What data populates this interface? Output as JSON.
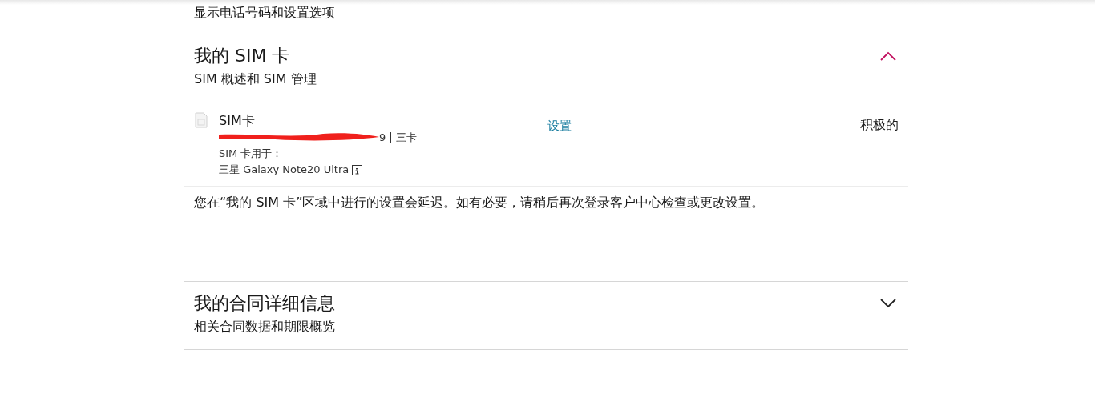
{
  "sections": [
    {
      "subtitle": "显示电话号码和设置选项"
    },
    {
      "title": "我的 SIM 卡",
      "subtitle": "SIM 概述和 SIM 管理",
      "expanded": true,
      "sim_cards": [
        {
          "name": "SIM卡",
          "number_visible": "9",
          "sim_type": "三卡",
          "used_for_label": "SIM 卡用于：",
          "device": "三星 Galaxy Note20 Ultra",
          "link": "设置",
          "status": "积极的"
        }
      ],
      "note": "您在“我的 SIM 卡”区域中进行的设置会延迟。如有必要，请稍后再次登录客户中心检查或更改设置。"
    },
    {
      "title": "我的合同详细信息",
      "subtitle": "相关合同数据和期限概览",
      "expanded": false
    }
  ]
}
